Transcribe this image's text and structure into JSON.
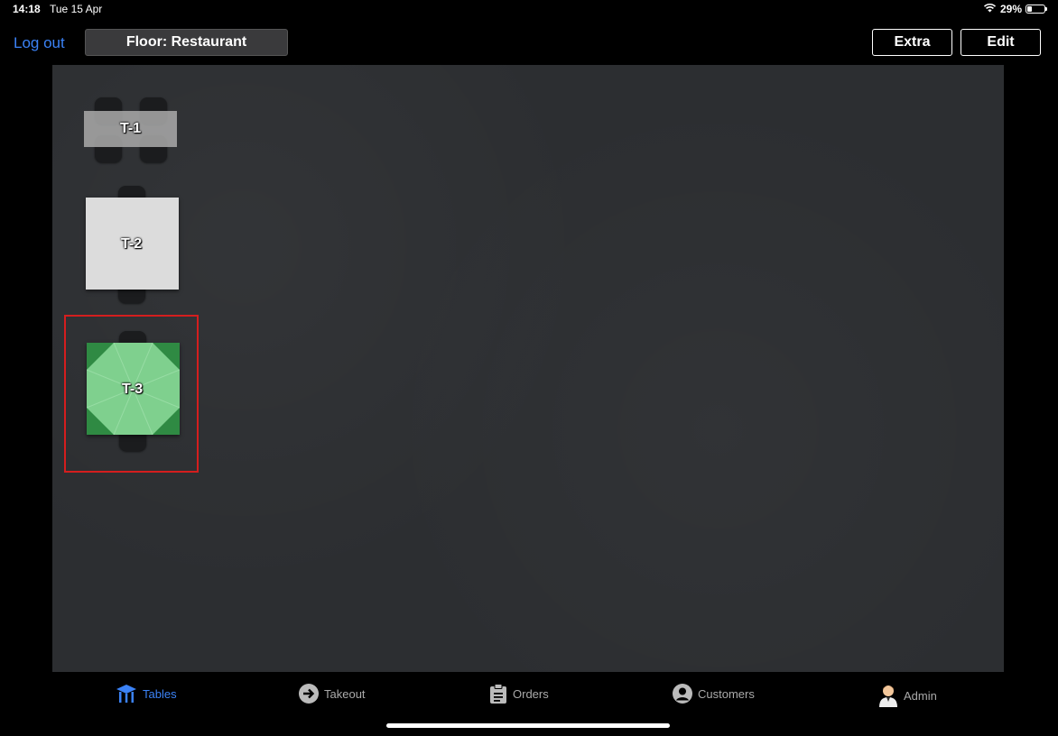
{
  "status": {
    "time": "14:18",
    "date": "Tue 15 Apr",
    "battery": "29%",
    "battery_level": 0.29
  },
  "header": {
    "logout_label": "Log out",
    "floor_label": "Floor: Restaurant",
    "extra_label": "Extra",
    "edit_label": "Edit"
  },
  "tables": [
    {
      "label": "T-1"
    },
    {
      "label": "T-2"
    },
    {
      "label": "T-3"
    }
  ],
  "tabs": [
    {
      "label": "Tables",
      "active": true
    },
    {
      "label": "Takeout"
    },
    {
      "label": "Orders"
    },
    {
      "label": "Customers"
    },
    {
      "label": "Admin"
    }
  ],
  "colors": {
    "accent": "#3b82f6",
    "selected_table": "#2f8a43",
    "selection_border": "#d41e1e",
    "floor": "#2c2e31"
  }
}
